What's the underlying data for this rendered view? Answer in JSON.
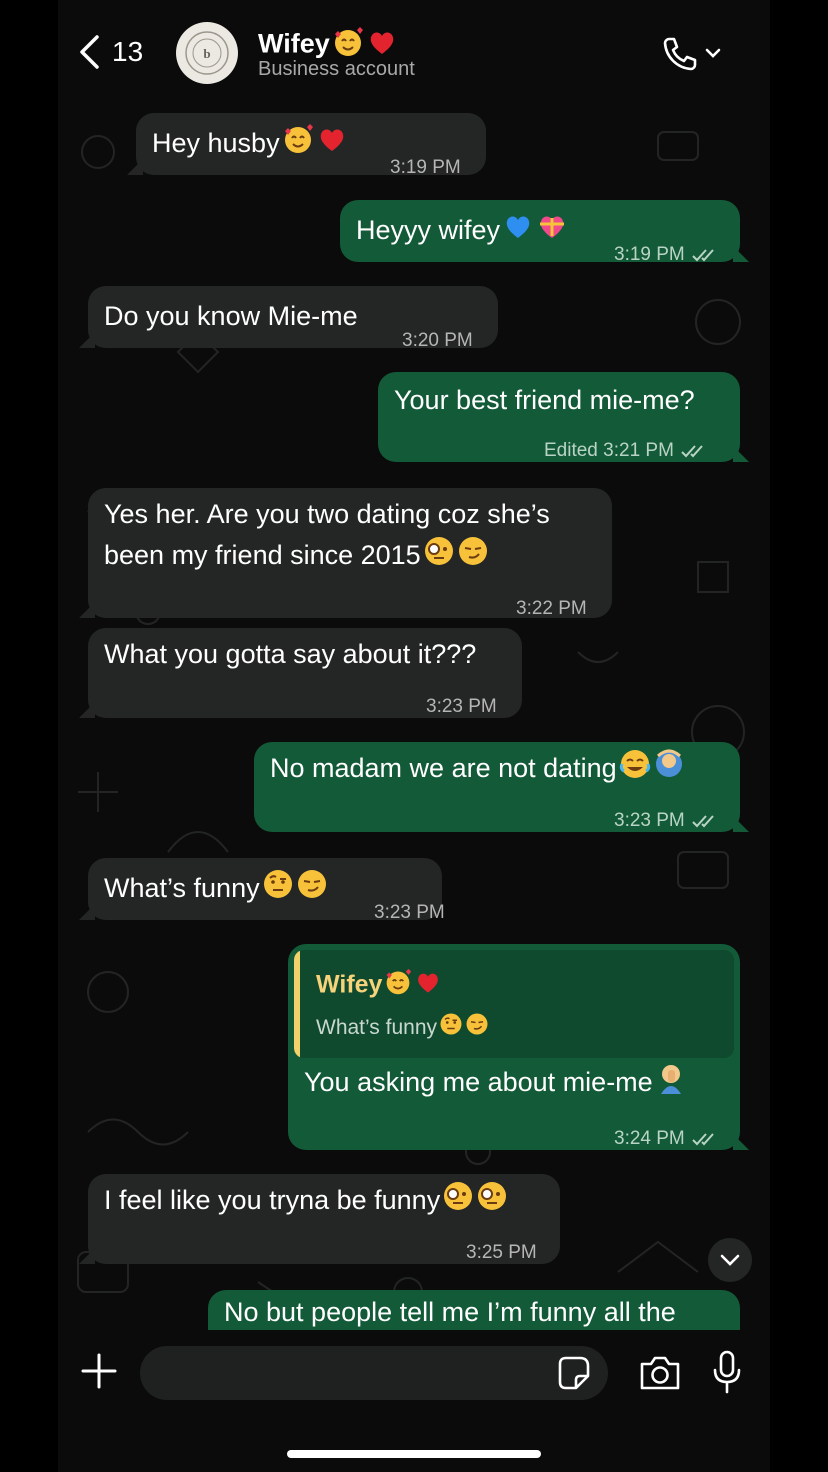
{
  "header": {
    "back_count": "13",
    "contact_name": "Wifey",
    "contact_name_emojis": [
      "smiling-face-hearts",
      "red-heart"
    ],
    "subtitle": "Business account"
  },
  "messages": [
    {
      "dir": "in",
      "text": "Hey husby",
      "emojis": [
        "smiling-face-hearts",
        "red-heart"
      ],
      "time": "3:19 PM"
    },
    {
      "dir": "out",
      "text": "Heyyy wifey",
      "emojis": [
        "blue-heart",
        "heart-with-ribbon"
      ],
      "time": "3:19 PM",
      "read": true
    },
    {
      "dir": "in",
      "text": "Do you know Mie-me",
      "emojis": [],
      "time": "3:20 PM"
    },
    {
      "dir": "out",
      "text": "Your best friend mie-me?",
      "emojis": [],
      "edited": "Edited",
      "time": "3:21 PM",
      "read": true
    },
    {
      "dir": "in",
      "line1": "Yes her. Are you two dating coz she’s",
      "line2": "been my friend since 2015",
      "emojis": [
        "face-with-monocle",
        "smirking-face"
      ],
      "time": "3:22 PM"
    },
    {
      "dir": "in",
      "text": "What you gotta say about it???",
      "emojis": [],
      "time": "3:23 PM"
    },
    {
      "dir": "out",
      "text": "No madam we are not dating",
      "emojis": [
        "face-with-tears-of-joy",
        "person-gesturing-ok"
      ],
      "time": "3:23 PM",
      "read": true
    },
    {
      "dir": "in",
      "text": "What’s funny",
      "emojis": [
        "face-with-raised-eyebrow",
        "smirking-face"
      ],
      "time": "3:23 PM"
    },
    {
      "dir": "out",
      "reply_to": {
        "name": "Wifey",
        "name_emojis": [
          "smiling-face-hearts",
          "red-heart"
        ],
        "text": "What’s funny",
        "emojis": [
          "face-with-raised-eyebrow",
          "smirking-face"
        ]
      },
      "text": "You asking me about mie-me",
      "emojis": [
        "person-facepalming"
      ],
      "time": "3:24 PM",
      "read": true
    },
    {
      "dir": "in",
      "text": "I feel like you tryna be funny",
      "emojis": [
        "face-with-monocle",
        "face-with-monocle"
      ],
      "time": "3:25 PM"
    },
    {
      "dir": "out",
      "text": "No but people tell me I’m funny all the",
      "emojis": [],
      "partial": true
    }
  ],
  "input": {
    "placeholder": "",
    "value": ""
  },
  "colors": {
    "incoming": "#242626",
    "outgoing": "#135a38",
    "background": "#0b0b0b",
    "quote_accent": "#f2d36b"
  }
}
